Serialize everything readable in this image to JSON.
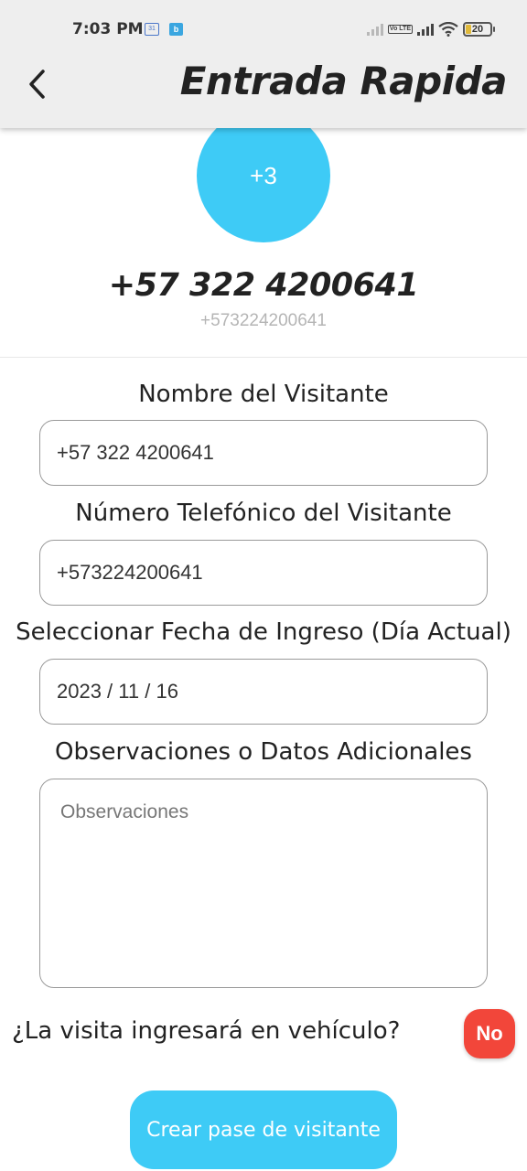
{
  "status_bar": {
    "time": "7:03 PM",
    "battery": "20",
    "volte": "Vo LTE"
  },
  "header": {
    "title": "Entrada Rapida"
  },
  "visitor": {
    "avatar_text": "+3",
    "display_number": "+57 322 4200641",
    "raw_number": "+573224200641"
  },
  "form": {
    "name_label": "Nombre del Visitante",
    "name_value": "+57 322 4200641",
    "phone_label": "Número Telefónico del Visitante",
    "phone_value": "+573224200641",
    "date_label": "Seleccionar Fecha de Ingreso (Día Actual)",
    "date_value": "2023 / 11 / 16",
    "notes_label": "Observaciones o Datos Adicionales",
    "notes_placeholder": "Observaciones"
  },
  "vehicle": {
    "question": "¿La visita ingresará en vehículo?",
    "toggle_label": "No"
  },
  "actions": {
    "create_label": "Crear pase de visitante"
  },
  "colors": {
    "accent": "#3ecbf6",
    "no_button": "#f2463a",
    "header_bg": "#eeeeee"
  }
}
